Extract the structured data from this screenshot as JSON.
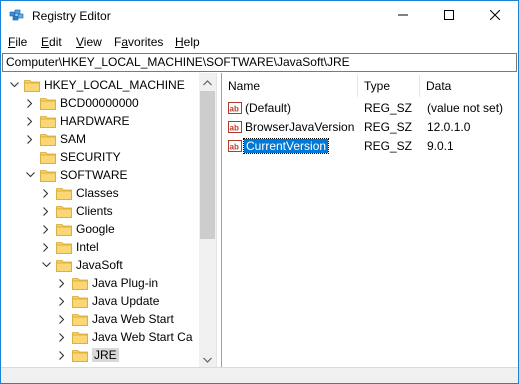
{
  "window": {
    "title": "Registry Editor",
    "icons": {
      "app": "registry-editor-icon",
      "minimize": "minimize-icon",
      "maximize": "maximize-icon",
      "close": "close-icon"
    }
  },
  "menu": [
    {
      "hot": "F",
      "rest": "ile"
    },
    {
      "hot": "E",
      "rest": "dit"
    },
    {
      "hot": "V",
      "rest": "iew"
    },
    {
      "hot": "",
      "pre": "F",
      "mid": "a",
      "rest": "vorites"
    },
    {
      "hot": "H",
      "rest": "elp"
    }
  ],
  "address": "Computer\\HKEY_LOCAL_MACHINE\\SOFTWARE\\JavaSoft\\JRE",
  "tree": [
    {
      "label": "HKEY_LOCAL_MACHINE",
      "chev": "down"
    },
    {
      "label": "BCD00000000",
      "chev": "right"
    },
    {
      "label": "HARDWARE",
      "chev": "right"
    },
    {
      "label": "SAM",
      "chev": "right"
    },
    {
      "label": "SECURITY",
      "chev": "none"
    },
    {
      "label": "SOFTWARE",
      "chev": "down"
    },
    {
      "label": "Classes",
      "chev": "right"
    },
    {
      "label": "Clients",
      "chev": "right"
    },
    {
      "label": "Google",
      "chev": "right"
    },
    {
      "label": "Intel",
      "chev": "right"
    },
    {
      "label": "JavaSoft",
      "chev": "down"
    },
    {
      "label": "Java Plug-in",
      "chev": "right"
    },
    {
      "label": "Java Update",
      "chev": "right"
    },
    {
      "label": "Java Web Start",
      "chev": "right"
    },
    {
      "label": "Java Web Start Ca",
      "chev": "right"
    },
    {
      "label": "JRE",
      "chev": "right",
      "selected": true
    }
  ],
  "columns": {
    "name": "Name",
    "type": "Type",
    "data": "Data"
  },
  "values": [
    {
      "name": "(Default)",
      "type": "REG_SZ",
      "data": "(value not set)"
    },
    {
      "name": "BrowserJavaVersion",
      "type": "REG_SZ",
      "data": "12.0.1.0"
    },
    {
      "name": "CurrentVersion",
      "type": "REG_SZ",
      "data": "9.0.1",
      "selected": true
    }
  ],
  "colors": {
    "accent": "#0078d7",
    "folder": "#f5c94a",
    "border": "#1883d7"
  }
}
